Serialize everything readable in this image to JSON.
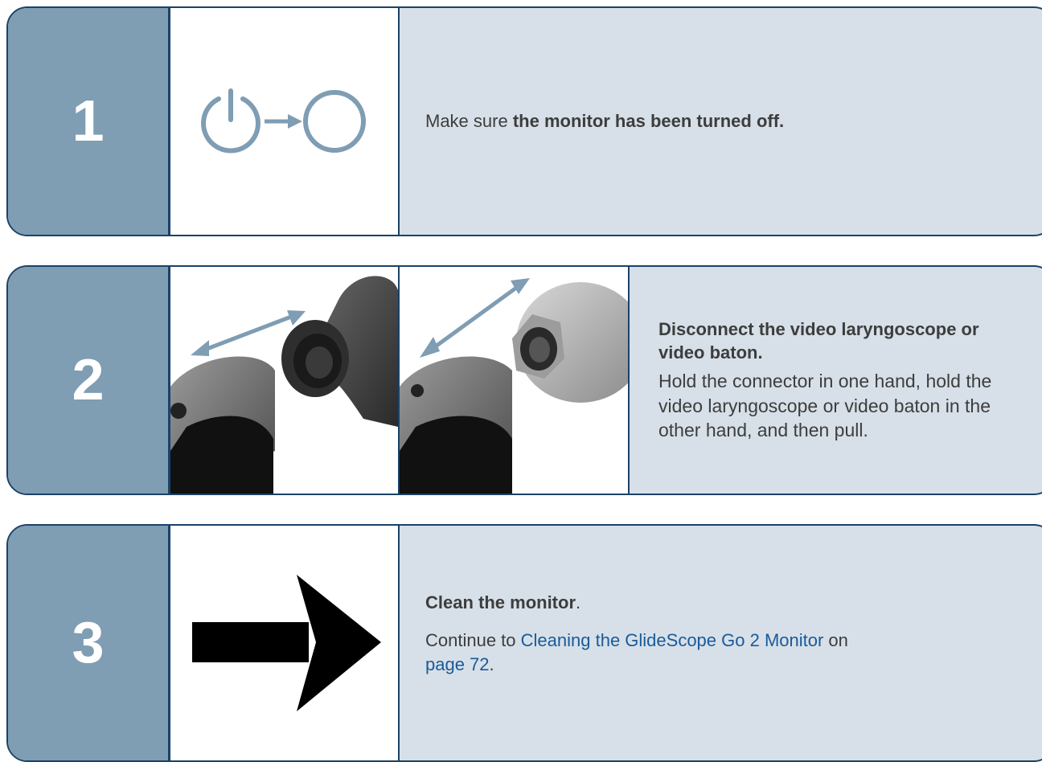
{
  "steps": [
    {
      "number": "1",
      "text_pre": "Make sure ",
      "text_bold": "the monitor has been turned off."
    },
    {
      "number": "2",
      "title": "Disconnect the video laryngoscope or video baton.",
      "body": "Hold the connector in one hand, hold the video laryngoscope or video baton in the other hand, and then pull."
    },
    {
      "number": "3",
      "title": "Clean the monitor",
      "title_end": ".",
      "body_pre": "Continue to ",
      "link_text": "Cleaning the GlideScope Go 2 Monitor",
      "body_mid": " on ",
      "page_link": "page 72",
      "body_end": "."
    }
  ],
  "colors": {
    "border": "#1a4268",
    "number_panel": "#7f9db3",
    "text_panel": "#d7e0e8",
    "icon": "#7f9db3",
    "link": "#1a5a9a"
  },
  "icons": [
    "power-off-to-off-icon",
    "disconnect-arrow-icon",
    "right-arrow-icon"
  ]
}
